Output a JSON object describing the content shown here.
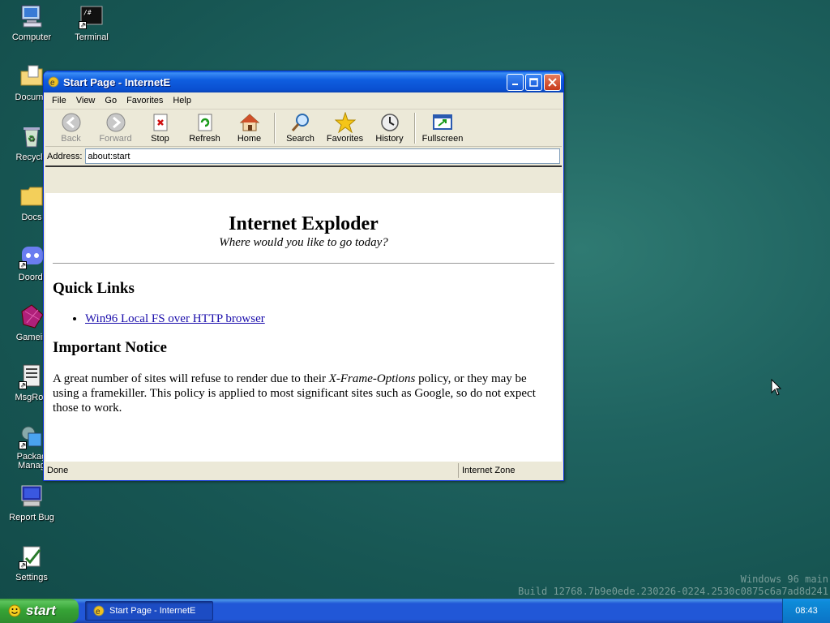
{
  "desktop": {
    "icons": [
      {
        "label": "Computer",
        "icon": "computer-icon"
      },
      {
        "label": "Terminal",
        "icon": "terminal-icon"
      },
      {
        "label": "Docume",
        "icon": "documents-icon"
      },
      {
        "label": "Recycle",
        "icon": "recycle-bin-icon"
      },
      {
        "label": "Docs",
        "icon": "folder-icon"
      },
      {
        "label": "Doordi",
        "icon": "discord-icon"
      },
      {
        "label": "Gamein",
        "icon": "game-icon"
      },
      {
        "label": "MsgRoo",
        "icon": "message-room-icon"
      },
      {
        "label": "Packag Manag",
        "icon": "package-manager-icon"
      },
      {
        "label": "Report Bug",
        "icon": "report-bug-icon"
      },
      {
        "label": "Settings",
        "icon": "settings-icon"
      }
    ]
  },
  "window": {
    "title": "Start Page - InternetE",
    "minimize_label": "_",
    "maximize_label": "□",
    "close_label": "✕",
    "menu": [
      "File",
      "View",
      "Go",
      "Favorites",
      "Help"
    ],
    "toolbar": [
      {
        "label": "Back",
        "icon": "back-arrow-icon",
        "enabled": false
      },
      {
        "label": "Forward",
        "icon": "forward-arrow-icon",
        "enabled": false
      },
      {
        "label": "Stop",
        "icon": "stop-icon",
        "enabled": true
      },
      {
        "label": "Refresh",
        "icon": "refresh-icon",
        "enabled": true
      },
      {
        "label": "Home",
        "icon": "home-icon",
        "enabled": true
      },
      {
        "label": "Search",
        "icon": "search-icon",
        "enabled": true
      },
      {
        "label": "Favorites",
        "icon": "favorites-star-icon",
        "enabled": true
      },
      {
        "label": "History",
        "icon": "history-icon",
        "enabled": true
      },
      {
        "label": "Fullscreen",
        "icon": "fullscreen-icon",
        "enabled": true
      }
    ],
    "address_label": "Address:",
    "address_value": "about:start",
    "page": {
      "heading": "Internet Exploder",
      "tagline": "Where would you like to go today?",
      "quick_links_heading": "Quick Links",
      "links": [
        "Win96 Local FS over HTTP browser"
      ],
      "notice_heading": "Important Notice",
      "notice_before": "A great number of sites will refuse to render due to their ",
      "notice_em": "X-Frame-Options",
      "notice_after": " policy, or they may be using a framekiller. This policy is applied to most significant sites such as Google, so do not expect those to work."
    },
    "status": {
      "text": "Done",
      "zone": "Internet Zone"
    }
  },
  "watermark": {
    "line1": "Windows 96 main",
    "line2": "Build 12768.7b9e0ede.230226-0224.2530c0875c6a7ad8d241"
  },
  "taskbar": {
    "start_label": "start",
    "task_label": "Start Page - InternetE",
    "clock": "08:43"
  },
  "colors": {
    "titlebar": "#0a4fd0",
    "taskbar": "#2157d7",
    "start": "#36a436",
    "link": "#1a0dab"
  }
}
